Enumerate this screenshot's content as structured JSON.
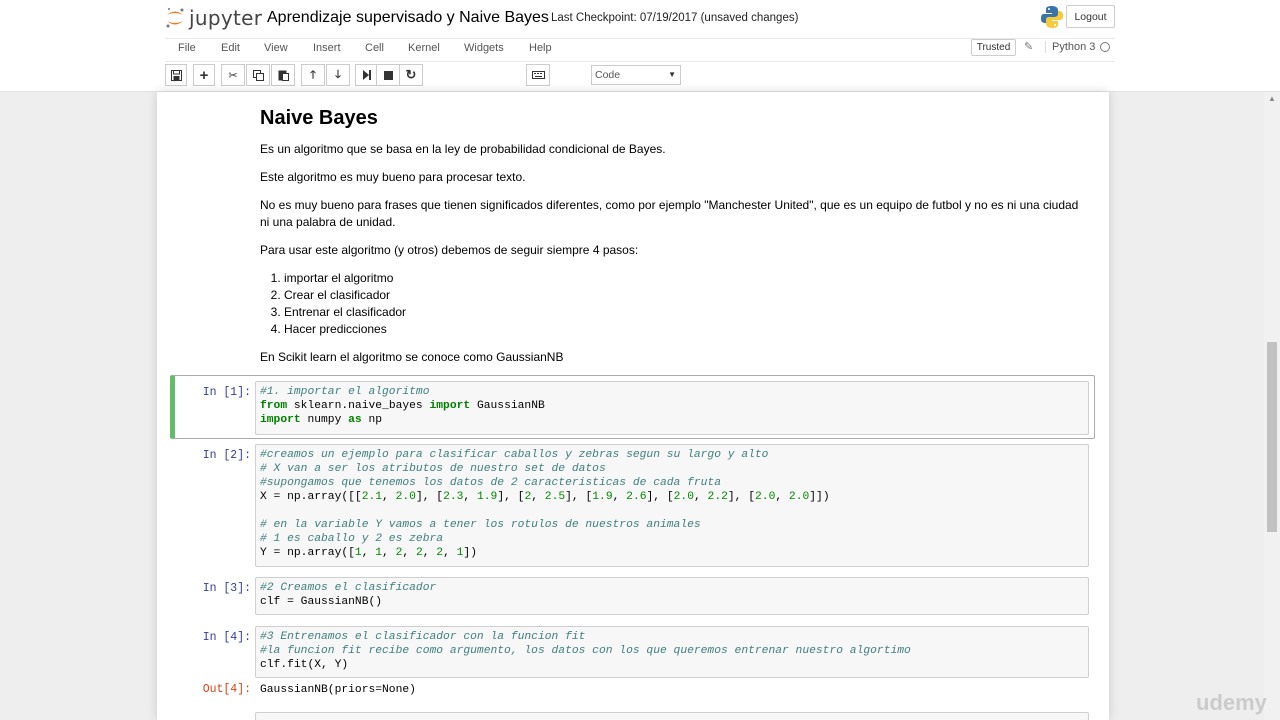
{
  "header": {
    "logo_text": "jupyter",
    "notebook_name": "Aprendizaje supervisado y Naive Bayes",
    "checkpoint": "Last Checkpoint: 07/19/2017 (unsaved changes)",
    "logout_label": "Logout"
  },
  "menu": [
    "File",
    "Edit",
    "View",
    "Insert",
    "Cell",
    "Kernel",
    "Widgets",
    "Help"
  ],
  "status": {
    "trusted": "Trusted",
    "kernel": "Python 3"
  },
  "toolbar": {
    "cell_type": "Code"
  },
  "markdown": {
    "title": "Naive Bayes",
    "p1": "Es un algoritmo que se basa en la ley de probabilidad condicional de Bayes.",
    "p2": "Este algoritmo es muy bueno para procesar texto.",
    "p3": "No es muy bueno para frases que tienen significados diferentes, como por ejemplo \"Manchester United\", que es un equipo de futbol y no es ni una ciudad ni una palabra de unidad.",
    "p4": "Para usar este algoritmo (y otros) debemos de seguir siempre 4 pasos:",
    "steps": [
      "importar el algoritmo",
      "Crear el clasificador",
      "Entrenar el clasificador",
      "Hacer predicciones"
    ],
    "p5": "En Scikit learn el algoritmo se conoce como GaussianNB"
  },
  "cells": [
    {
      "prompt": "In [1]:",
      "lines": [
        "#1. importar el algoritmo",
        "from sklearn.naive_bayes import GaussianNB",
        "import numpy as np"
      ]
    },
    {
      "prompt": "In [2]:",
      "lines": [
        "#creamos un ejemplo para clasificar caballos y zebras segun su largo y alto",
        "# X van a ser los atributos de nuestro set de datos",
        "#supongamos que tenemos los datos de 2 caracteristicas de cada fruta",
        "X = np.array([[2.1, 2.0], [2.3, 1.9], [2, 2.5], [1.9, 2.6], [2.0, 2.2], [2.0, 2.0]])",
        "",
        "# en la variable Y vamos a tener los rotulos de nuestros animales",
        "# 1 es caballo y 2 es zebra",
        "Y = np.array([1, 1, 2, 2, 2, 1])"
      ]
    },
    {
      "prompt": "In [3]:",
      "lines": [
        "#2 Creamos el clasificador",
        "clf = GaussianNB()"
      ]
    },
    {
      "prompt": "In [4]:",
      "lines": [
        "#3 Entrenamos el clasificador con la funcion fit",
        "#la funcion fit recibe como argumento, los datos con los que queremos entrenar nuestro algortimo",
        "clf.fit(X, Y)"
      ],
      "out_prompt": "Out[4]:",
      "output": "GaussianNB(priors=None)"
    }
  ],
  "watermark": "udemy"
}
